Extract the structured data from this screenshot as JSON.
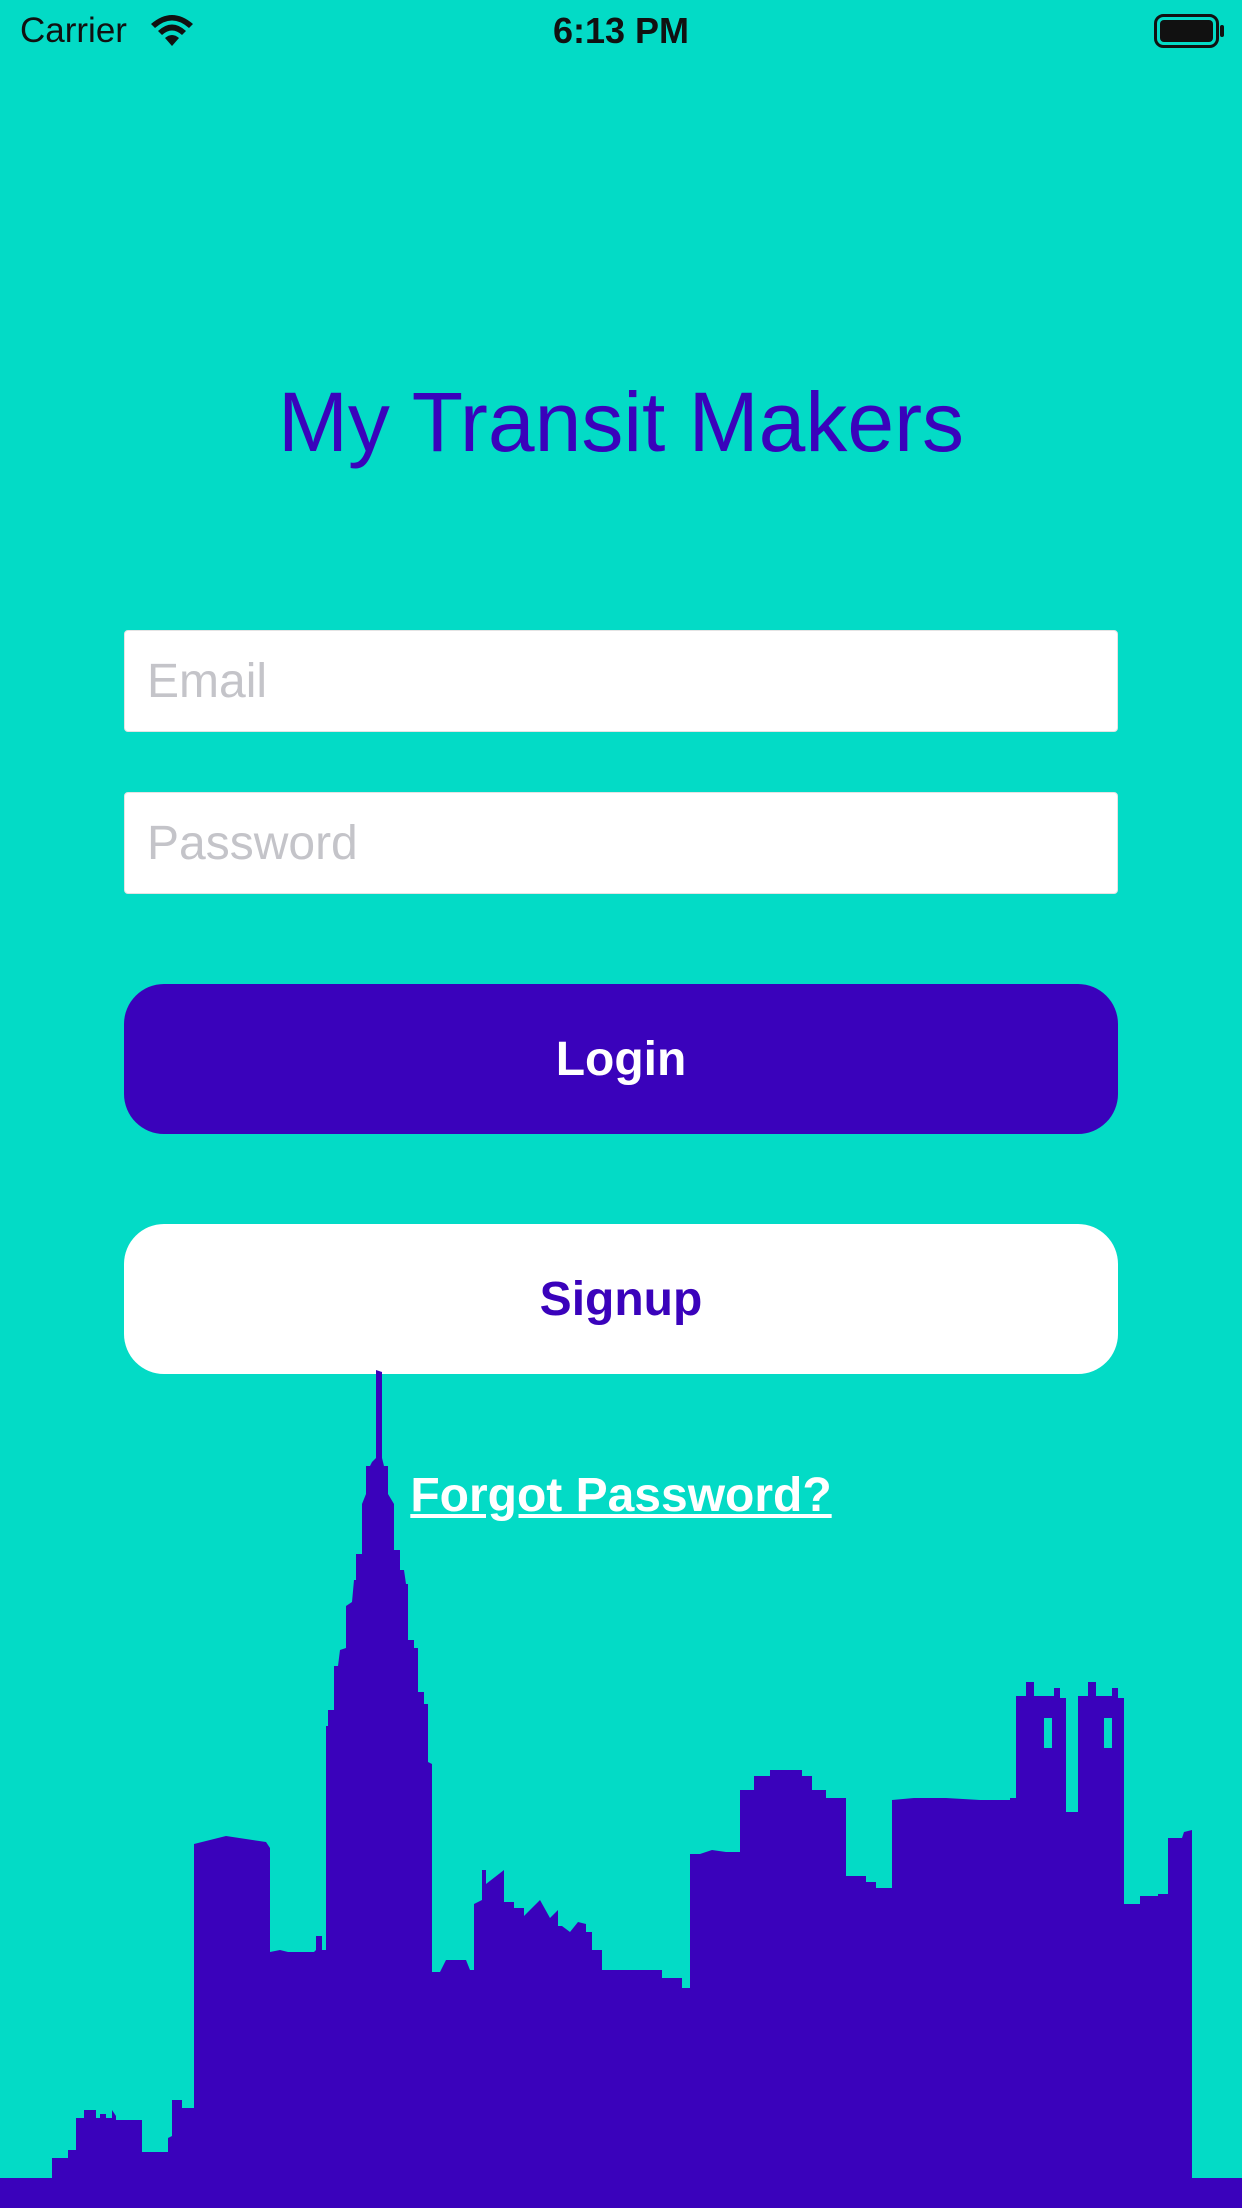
{
  "status_bar": {
    "carrier": "Carrier",
    "time": "6:13 PM",
    "wifi_icon": "wifi-icon",
    "battery_icon": "battery-icon"
  },
  "app": {
    "title": "My Transit Makers"
  },
  "form": {
    "email_placeholder": "Email",
    "password_placeholder": "Password",
    "login_label": "Login",
    "signup_label": "Signup",
    "forgot_label": "Forgot Password?"
  },
  "colors": {
    "background": "#03dbc6",
    "accent": "#3a02bb",
    "button_text_light": "#ffffff"
  },
  "illustration": {
    "icon": "city-skyline-silhouette"
  }
}
